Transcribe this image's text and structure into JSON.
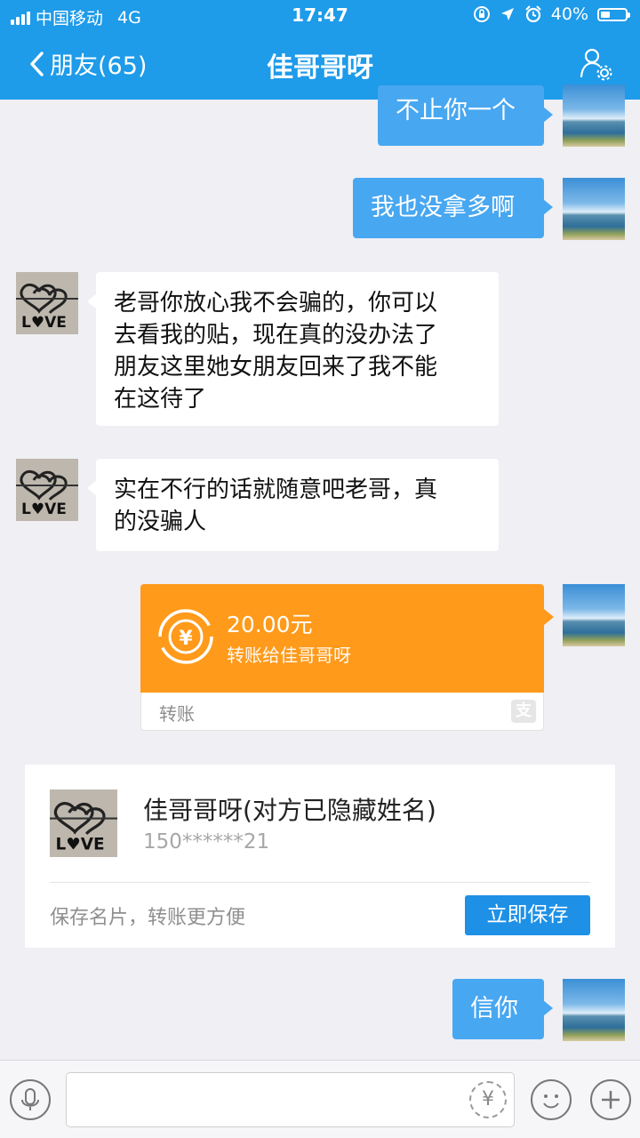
{
  "status_bar": {
    "carrier": "中国移动",
    "network": "4G",
    "time": "17:47",
    "battery": "40%",
    "battery_level": 0.4
  },
  "nav": {
    "back_label": "朋友(65)",
    "title": "佳哥哥呀"
  },
  "messages": {
    "m1": "不止你一个",
    "m2": "我也没拿多啊",
    "m3_lines": [
      "老哥你放心我不会骗的，你可以",
      "去看我的贴，现在真的没办法了",
      "朋友这里她女朋友回来了我不能",
      "在这待了"
    ],
    "m4_lines": [
      "实在不行的话就随意吧老哥，真",
      "的没骗人"
    ],
    "m5": "信你"
  },
  "transfer": {
    "amount": "20.00元",
    "description": "转账给佳哥哥呀",
    "type_label": "转账",
    "brand_glyph": "支",
    "icon_glyph": "¥"
  },
  "contact_card": {
    "name": "佳哥哥呀(对方已隐藏姓名)",
    "phone": "150******21",
    "hint": "保存名片，转账更方便",
    "save_button": "立即保存"
  },
  "toolbar": {
    "yen_glyph": "¥"
  },
  "colors": {
    "nav_blue": "#1e9be9",
    "bubble_blue": "#48a7f1",
    "transfer_orange": "#ff9a1a",
    "button_blue": "#1e90e6"
  }
}
